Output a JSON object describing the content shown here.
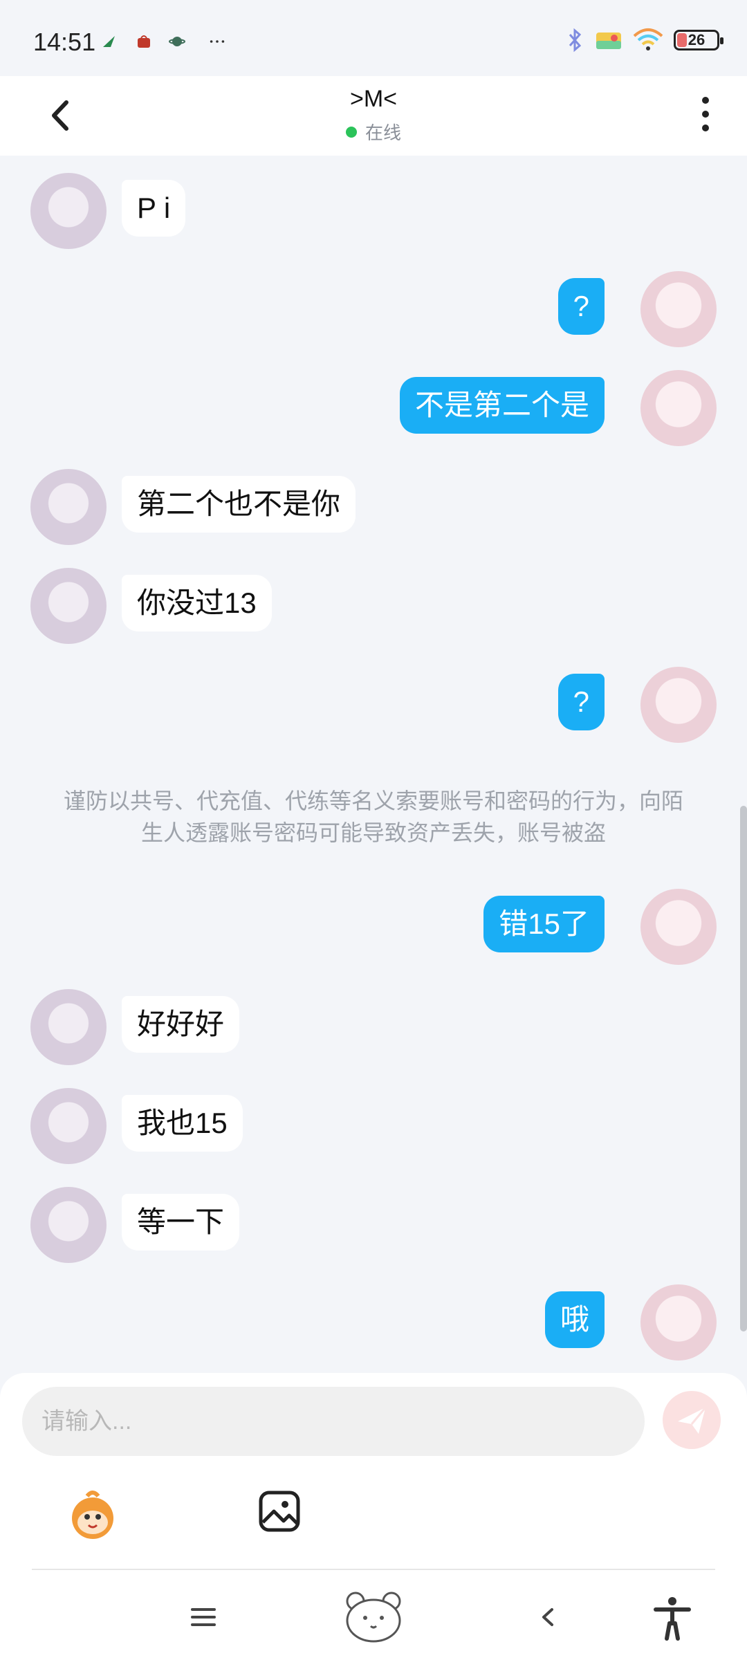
{
  "status_bar": {
    "time": "14:51",
    "battery": "26"
  },
  "header": {
    "title": ">M<",
    "status": "在线"
  },
  "messages": [
    {
      "side": "left",
      "text": "P i"
    },
    {
      "side": "right",
      "text": "?"
    },
    {
      "side": "right",
      "text": "不是第二个是"
    },
    {
      "side": "left",
      "text": "第二个也不是你"
    },
    {
      "side": "left",
      "text": "你没过13"
    },
    {
      "side": "right",
      "text": "?"
    },
    {
      "side": "right",
      "text": "错15了"
    },
    {
      "side": "left",
      "text": "好好好"
    },
    {
      "side": "left",
      "text": "我也15"
    },
    {
      "side": "left",
      "text": "等一下"
    },
    {
      "side": "right",
      "text": "哦"
    }
  ],
  "notice": "谨防以共号、代充值、代练等名义索要账号和密码的行为，向陌生人透露账号密码可能导致资产丢失，账号被盗",
  "composer": {
    "placeholder": "请输入..."
  },
  "colors": {
    "accent": "#1aaef5",
    "online_dot": "#2bc35a",
    "send_button": "#fbe1e1"
  },
  "icons": [
    "back-arrow-icon",
    "more-vertical-icon",
    "send-icon",
    "emoji-icon",
    "image-icon",
    "menu-icon",
    "bear-home-icon",
    "nav-back-icon",
    "accessibility-icon"
  ]
}
